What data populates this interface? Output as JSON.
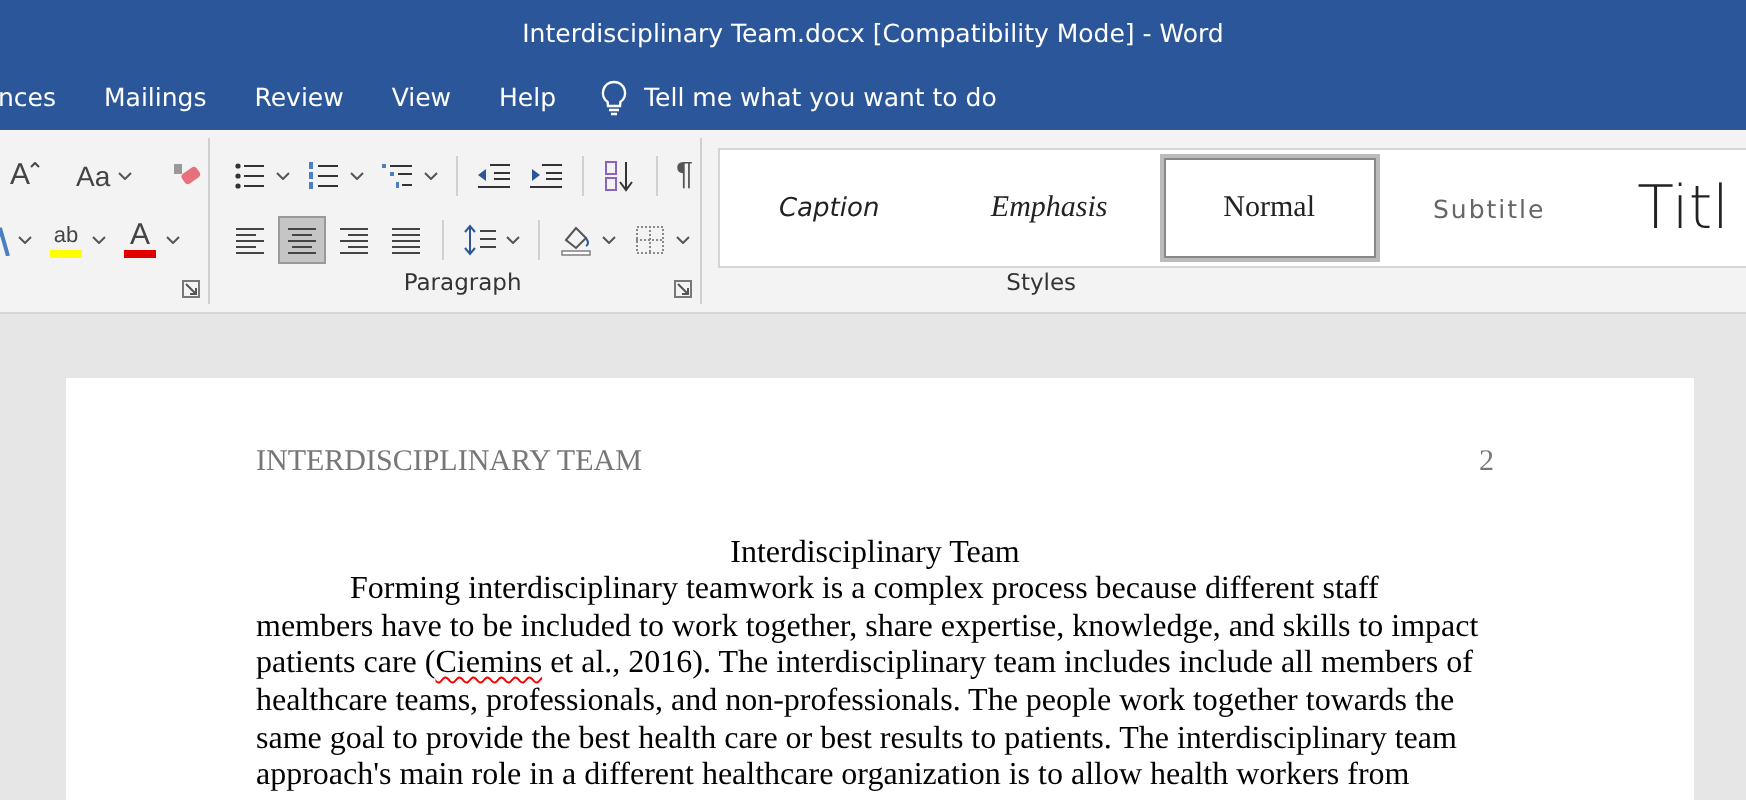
{
  "window": {
    "title": "Interdisciplinary Team.docx [Compatibility Mode]  -  Word"
  },
  "menu_tabs": [
    {
      "label": "nces",
      "selected": false
    },
    {
      "label": "Mailings",
      "selected": false
    },
    {
      "label": "Review",
      "selected": false
    },
    {
      "label": "View",
      "selected": false
    },
    {
      "label": "Help",
      "selected": false
    }
  ],
  "tell_me": {
    "placeholder": "Tell me what you want to do"
  },
  "font_group": {
    "row_1": [
      {
        "kind": "grow-font",
        "glyph": "A",
        "dropdown": false
      },
      {
        "kind": "change-case",
        "glyph": "Aa",
        "dropdown": true
      },
      {
        "kind": "clear-formatting",
        "dropdown": false
      }
    ],
    "row_2": [
      {
        "kind": "text-effects",
        "dropdown": true
      },
      {
        "kind": "highlight",
        "glyph": "ab",
        "dropdown": true
      },
      {
        "kind": "font-color",
        "glyph": "A",
        "dropdown": true
      }
    ]
  },
  "paragraph_group": {
    "label": "Paragraph",
    "row_1": [
      {
        "kind": "bullets",
        "dropdown": true,
        "selected": false
      },
      {
        "kind": "numbering",
        "dropdown": true,
        "selected": false
      },
      {
        "kind": "multilevel",
        "dropdown": true,
        "selected": false
      },
      {
        "kind": "separator"
      },
      {
        "kind": "decrease-indent",
        "dropdown": false,
        "selected": false
      },
      {
        "kind": "increase-indent",
        "dropdown": false,
        "selected": false
      },
      {
        "kind": "separator"
      },
      {
        "kind": "sort",
        "dropdown": false,
        "selected": false
      },
      {
        "kind": "separator"
      },
      {
        "kind": "pilcrow",
        "glyph": "¶",
        "dropdown": false,
        "selected": false
      }
    ],
    "row_2": [
      {
        "kind": "align-left",
        "dropdown": false,
        "selected": false
      },
      {
        "kind": "align-center",
        "dropdown": false,
        "selected": true
      },
      {
        "kind": "align-right",
        "dropdown": false,
        "selected": false
      },
      {
        "kind": "justify",
        "dropdown": false,
        "selected": false
      },
      {
        "kind": "separator"
      },
      {
        "kind": "line-spacing",
        "dropdown": true,
        "selected": false
      },
      {
        "kind": "separator"
      },
      {
        "kind": "shading",
        "dropdown": true,
        "selected": false
      },
      {
        "kind": "borders",
        "dropdown": true,
        "selected": false
      }
    ]
  },
  "styles_group": {
    "label": "Styles",
    "items": [
      {
        "label": "Caption",
        "kind": "caption",
        "selected": false
      },
      {
        "label": "Emphasis",
        "kind": "emphasis",
        "selected": false
      },
      {
        "label": "Normal",
        "kind": "normal",
        "selected": true
      },
      {
        "label": "Subtitle",
        "kind": "subtitle",
        "selected": false
      },
      {
        "label": "Titl",
        "kind": "title",
        "selected": false
      }
    ]
  },
  "document": {
    "header": {
      "title": "INTERDISCIPLINARY TEAM",
      "page_number": "2"
    },
    "heading": "Interdisciplinary Team",
    "paragraph": [
      {
        "text": "Forming interdisciplinary teamwork is a complex process because different staff members have to be included to work together, share expertise, knowledge, and skills to impact patients care (",
        "spelling_error": false
      },
      {
        "text": "Ciemins",
        "spelling_error": true
      },
      {
        "text": " et al., 2016). The interdisciplinary team includes include all members of healthcare teams, professionals, and non-professionals. The people work together towards the same goal to provide the best health care or best results to patients. The interdisciplinary team approach's main role in a different healthcare organization is to allow health workers from",
        "spelling_error": false
      }
    ]
  }
}
